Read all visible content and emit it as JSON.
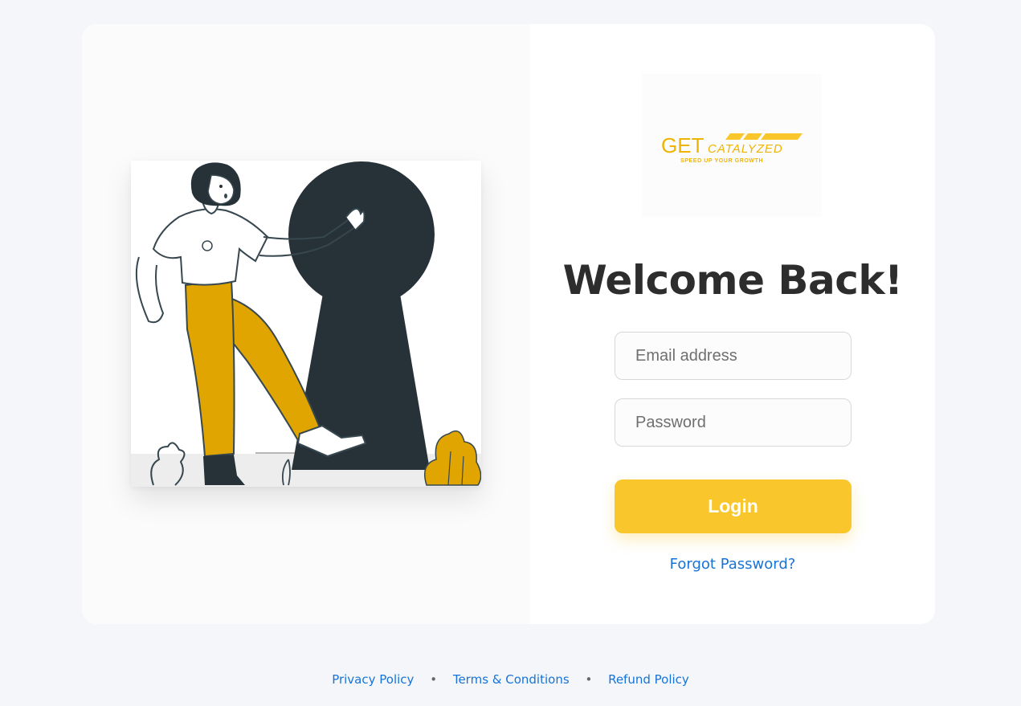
{
  "brand": {
    "logo_main": "GET",
    "logo_sub": "CATALYZED",
    "tagline": "SPEED UP YOUR GROWTH"
  },
  "login": {
    "heading": "Welcome Back!",
    "email_placeholder": "Email address",
    "password_placeholder": "Password",
    "login_label": "Login",
    "forgot_label": "Forgot Password?"
  },
  "footer": {
    "links": [
      "Privacy Policy",
      "Terms & Conditions",
      "Refund Policy"
    ],
    "separator": "•"
  },
  "colors": {
    "accent": "#f9c62b",
    "link": "#1773d6",
    "heading": "#2d2d2d",
    "background": "#f5f6f9",
    "keyhole": "#263238",
    "pants": "#e0a500"
  },
  "icons": {
    "illustration": "woman-kicking-keyhole-illustration",
    "logo": "getcatalyzed-logo"
  }
}
